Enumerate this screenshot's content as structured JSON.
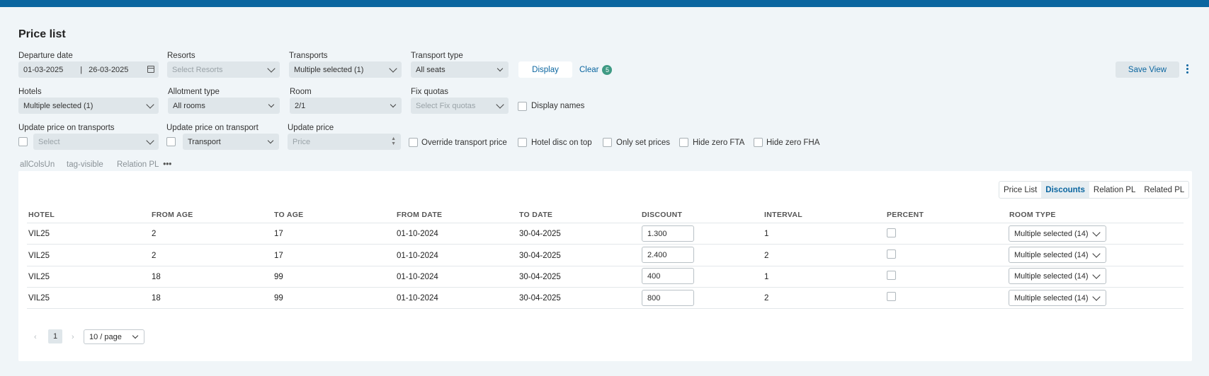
{
  "page": {
    "title": "Price list"
  },
  "filters": {
    "departure_date": {
      "label": "Departure date",
      "from": "01-03-2025",
      "separator": "|",
      "to": "26-03-2025",
      "icon": "calendar-icon"
    },
    "resorts": {
      "label": "Resorts",
      "placeholder": "Select Resorts"
    },
    "transports": {
      "label": "Transports",
      "value": "Multiple selected (1)"
    },
    "transport_type": {
      "label": "Transport type",
      "value": "All seats"
    },
    "display_button": "Display",
    "clear_button": "Clear",
    "clear_count": "5",
    "save_view_button": "Save View",
    "hotels": {
      "label": "Hotels",
      "value": "Multiple selected (1)"
    },
    "allotment_type": {
      "label": "Allotment type",
      "value": "All rooms"
    },
    "room": {
      "label": "Room",
      "value": "2/1"
    },
    "fix_quotas": {
      "label": "Fix quotas",
      "placeholder": "Select Fix quotas"
    },
    "display_names": "Display names",
    "update_price_on_transports": {
      "label": "Update price on transports",
      "placeholder": "Select"
    },
    "update_price_on_transport": {
      "label": "Update price on transport",
      "value": "Transport"
    },
    "update_price": {
      "label": "Update price",
      "placeholder": "Price"
    },
    "options": [
      "Override transport price",
      "Hotel disc on top",
      "Only set prices",
      "Hide zero FTA",
      "Hide zero FHA"
    ]
  },
  "tags": [
    "allColsUn",
    "tag-visible",
    "Relation PL"
  ],
  "view_tabs": [
    {
      "label": "Price List",
      "active": false
    },
    {
      "label": "Discounts",
      "active": true
    },
    {
      "label": "Relation PL",
      "active": false
    },
    {
      "label": "Related PL",
      "active": false
    }
  ],
  "table": {
    "columns": [
      "HOTEL",
      "FROM AGE",
      "TO AGE",
      "FROM DATE",
      "TO DATE",
      "DISCOUNT",
      "INTERVAL",
      "PERCENT",
      "ROOM TYPE"
    ],
    "rows": [
      {
        "hotel": "VIL25",
        "from_age": "2",
        "to_age": "17",
        "from_date": "01-10-2024",
        "to_date": "30-04-2025",
        "discount": "1.300",
        "interval": "1",
        "percent": false,
        "room_type": "Multiple selected (14)"
      },
      {
        "hotel": "VIL25",
        "from_age": "2",
        "to_age": "17",
        "from_date": "01-10-2024",
        "to_date": "30-04-2025",
        "discount": "2.400",
        "interval": "2",
        "percent": false,
        "room_type": "Multiple selected (14)"
      },
      {
        "hotel": "VIL25",
        "from_age": "18",
        "to_age": "99",
        "from_date": "01-10-2024",
        "to_date": "30-04-2025",
        "discount": "400",
        "interval": "1",
        "percent": false,
        "room_type": "Multiple selected (14)"
      },
      {
        "hotel": "VIL25",
        "from_age": "18",
        "to_age": "99",
        "from_date": "01-10-2024",
        "to_date": "30-04-2025",
        "discount": "800",
        "interval": "2",
        "percent": false,
        "room_type": "Multiple selected (14)"
      }
    ]
  },
  "pagination": {
    "prev": "‹",
    "current": "1",
    "next": "›",
    "page_size": "10 / page"
  },
  "colors": {
    "accent": "#0b66a0",
    "badge": "#3f9a84",
    "background": "#f0f5f8"
  }
}
